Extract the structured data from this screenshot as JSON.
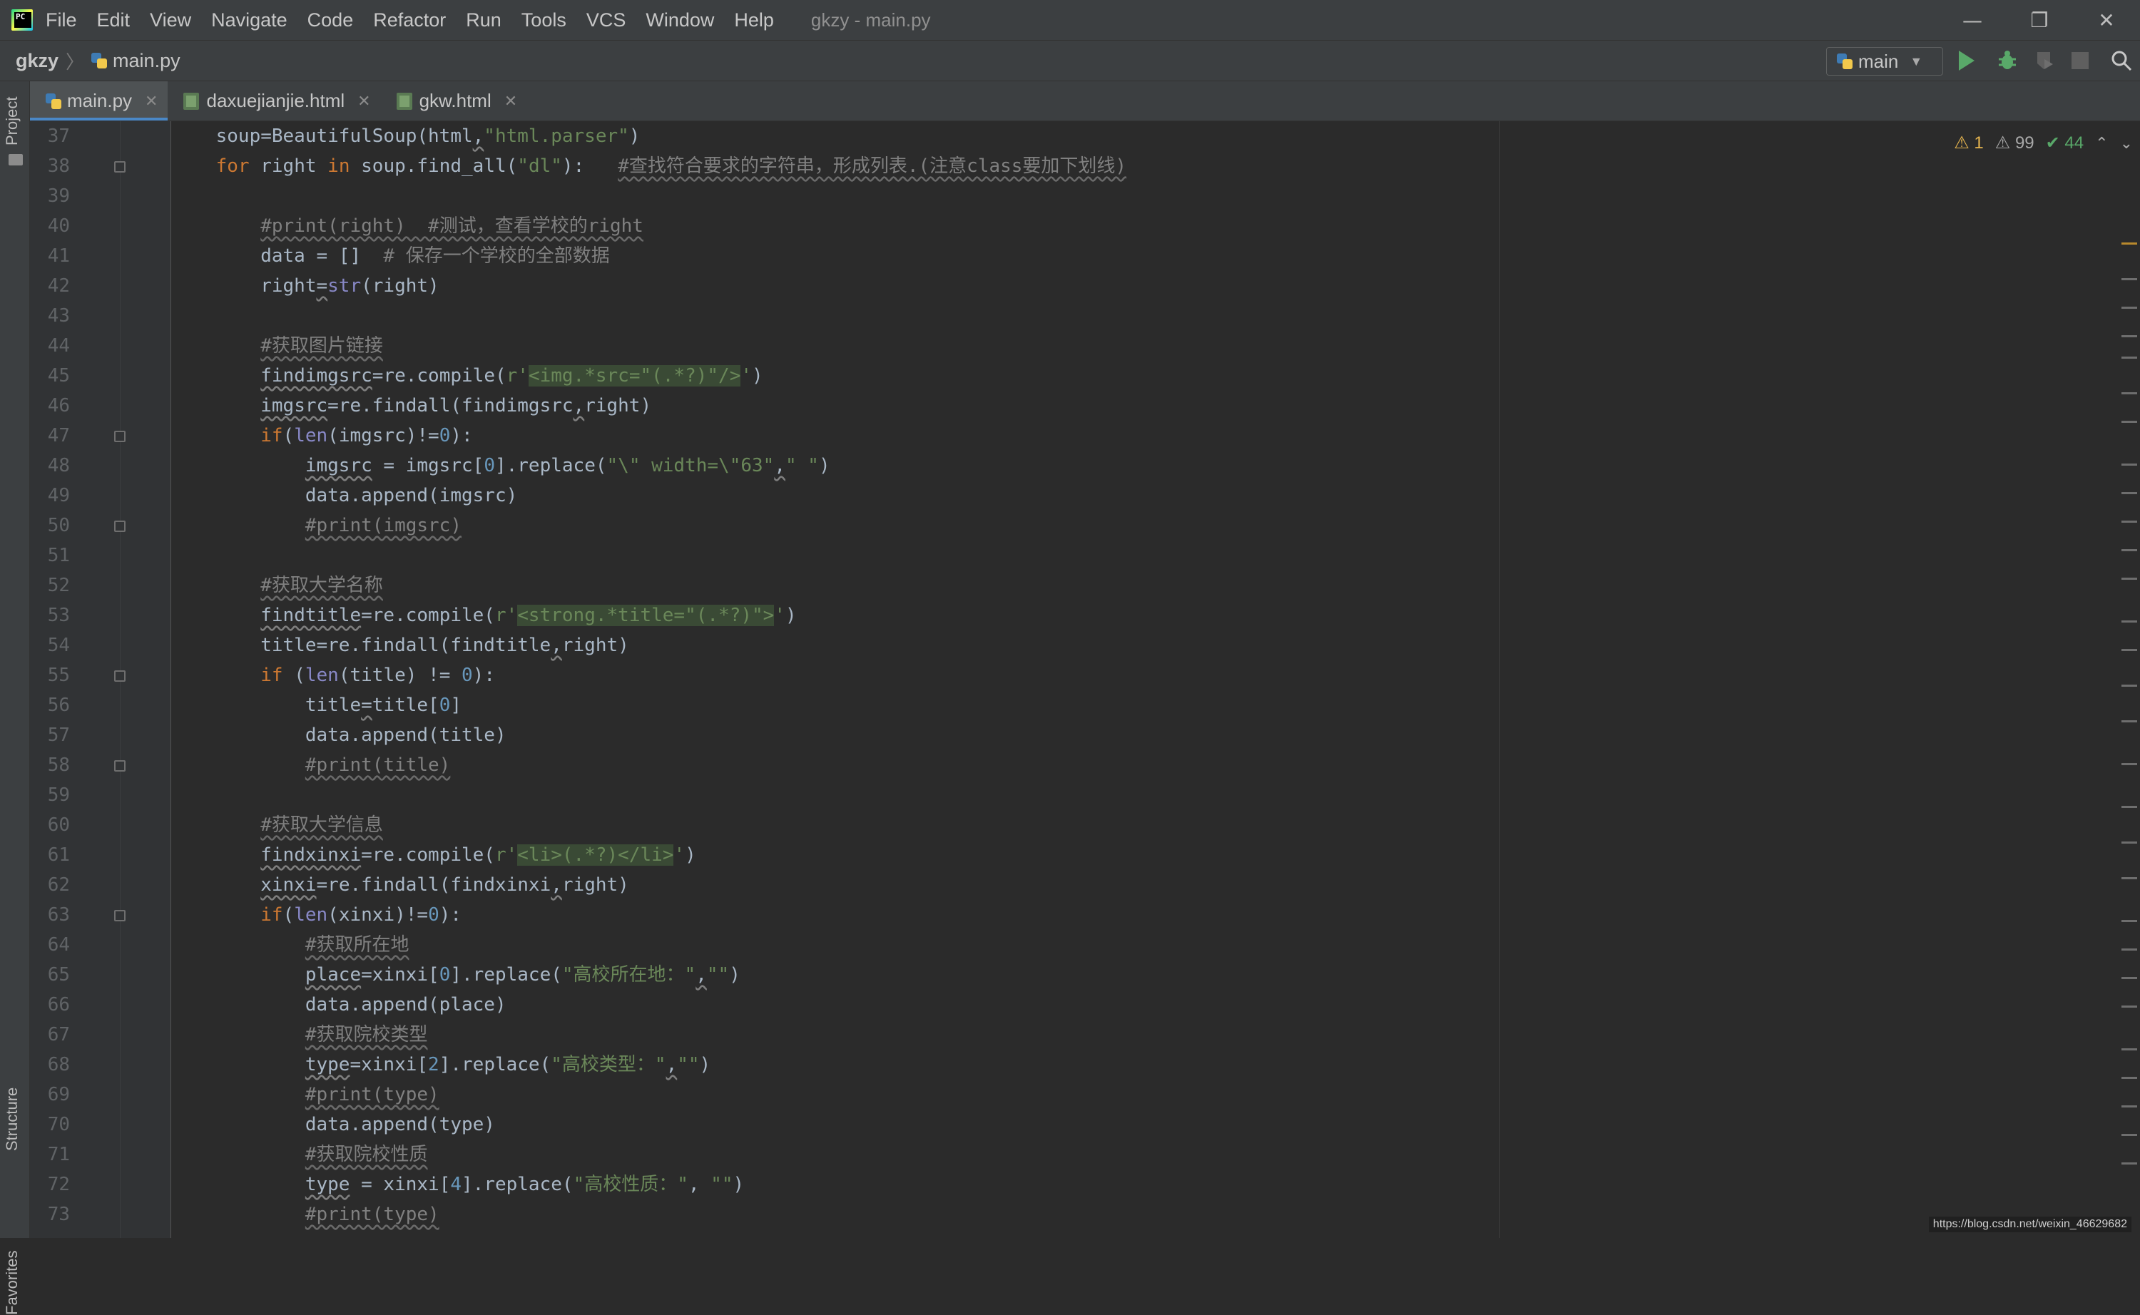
{
  "menu": {
    "items": [
      "File",
      "Edit",
      "View",
      "Navigate",
      "Code",
      "Refactor",
      "Run",
      "Tools",
      "VCS",
      "Window",
      "Help"
    ],
    "window_title": "gkzy - main.py"
  },
  "window_controls": {
    "minimize": "—",
    "restore": "❐",
    "close": "✕"
  },
  "navbar": {
    "project": "gkzy",
    "separator": "〉",
    "file": "main.py",
    "run_config": "main"
  },
  "left_strip": {
    "project_label": "Project",
    "structure_label": "Structure",
    "favorites_label": "Favorites"
  },
  "tabs": [
    {
      "label": "main.py",
      "active": true
    },
    {
      "label": "daxuejianjie.html",
      "active": false
    },
    {
      "label": "gkw.html",
      "active": false
    }
  ],
  "tab_close": "✕",
  "inspections": {
    "errors": "1",
    "warnings": "99",
    "ok": "44"
  },
  "watermark": "https://blog.csdn.net/weixin_46629682",
  "colors": {
    "keyword": "#cc7832",
    "string": "#6a8759",
    "comment": "#808080",
    "number": "#6897bb",
    "accent_tab": "#4a88c7"
  },
  "code": [
    {
      "n": "37",
      "fold": false,
      "html": "    soup=BeautifulSoup(html<span class=\"ul\">,</span><span class=\"str\">\"html.parser\"</span>)"
    },
    {
      "n": "38",
      "fold": true,
      "html": "    <span class=\"kw\">for</span> right <span class=\"kw\">in</span> soup.find_all(<span class=\"str\">\"dl\"</span>):   <span class=\"cm\">#查找符合要求的字符串，形成列表.(注意class要加下划线)</span>"
    },
    {
      "n": "39",
      "fold": false,
      "html": ""
    },
    {
      "n": "40",
      "fold": false,
      "html": "        <span class=\"cm\">#print(right)  #测试，查看学校的right</span>"
    },
    {
      "n": "41",
      "fold": false,
      "html": "        data = []  <span class=\"cm\" style=\"text-decoration:none\"># 保存一个学校的全部数据</span>"
    },
    {
      "n": "42",
      "fold": false,
      "html": "        right<span class=\"ul\">=</span><span class=\"bi\">str</span>(right)"
    },
    {
      "n": "43",
      "fold": false,
      "html": ""
    },
    {
      "n": "44",
      "fold": false,
      "html": "        <span class=\"cm\">#获取图片链接</span>"
    },
    {
      "n": "45",
      "fold": false,
      "html": "        <span class=\"ul\">findimgsrc</span>=re.compile(<span class=\"str\">r'</span><span class=\"str rx\">&lt;img.*src=\"(.*?)\"/&gt;</span><span class=\"str\">'</span>)"
    },
    {
      "n": "46",
      "fold": false,
      "html": "        <span class=\"ul\">imgsrc</span>=re.findall(findimgsrc<span class=\"ul\">,</span>right)"
    },
    {
      "n": "47",
      "fold": true,
      "html": "        <span class=\"kw\">if</span>(<span class=\"bi\">len</span>(imgsrc)!=<span class=\"num\">0</span>):"
    },
    {
      "n": "48",
      "fold": false,
      "html": "            <span class=\"ul\">imgsrc</span> = imgsrc[<span class=\"num\">0</span>].replace(<span class=\"str\">\"\\\" width=\\\"63\"</span><span class=\"ul\">,</span><span class=\"str\">\" \"</span>)"
    },
    {
      "n": "49",
      "fold": false,
      "html": "            data.append(imgsrc)"
    },
    {
      "n": "50",
      "fold": true,
      "html": "            <span class=\"cm\">#print(imgsrc)</span>"
    },
    {
      "n": "51",
      "fold": false,
      "html": ""
    },
    {
      "n": "52",
      "fold": false,
      "html": "        <span class=\"cm\">#获取大学名称</span>"
    },
    {
      "n": "53",
      "fold": false,
      "html": "        <span class=\"ul\">findtitle</span>=re.compile(<span class=\"str\">r'</span><span class=\"str rx\">&lt;strong.*title=\"(.*?)\"&gt;</span><span class=\"str\">'</span>)"
    },
    {
      "n": "54",
      "fold": false,
      "html": "        title=re.findall(findtitle<span class=\"ul\">,</span>right)"
    },
    {
      "n": "55",
      "fold": true,
      "html": "        <span class=\"kw\">if</span> (<span class=\"bi\">len</span>(title) != <span class=\"num\">0</span>):"
    },
    {
      "n": "56",
      "fold": false,
      "html": "            title<span class=\"ul\">=</span>title[<span class=\"num\">0</span>]"
    },
    {
      "n": "57",
      "fold": false,
      "html": "            data.append(title)"
    },
    {
      "n": "58",
      "fold": true,
      "html": "            <span class=\"cm\">#print(title)</span>"
    },
    {
      "n": "59",
      "fold": false,
      "html": ""
    },
    {
      "n": "60",
      "fold": false,
      "html": "        <span class=\"cm\">#获取大学信息</span>"
    },
    {
      "n": "61",
      "fold": false,
      "html": "        <span class=\"ul\">findxinxi</span>=re.compile(<span class=\"str\">r'</span><span class=\"str rx\">&lt;li&gt;(.*?)&lt;/li&gt;</span><span class=\"str\">'</span>)"
    },
    {
      "n": "62",
      "fold": false,
      "html": "        <span class=\"ul\">xinxi</span>=re.findall(findxinxi<span class=\"ul\">,</span>right)"
    },
    {
      "n": "63",
      "fold": true,
      "html": "        <span class=\"kw\">if</span>(<span class=\"bi\">len</span>(xinxi)!=<span class=\"num\">0</span>):"
    },
    {
      "n": "64",
      "fold": false,
      "html": "            <span class=\"cm\">#获取所在地</span>"
    },
    {
      "n": "65",
      "fold": false,
      "html": "            <span class=\"ul\">place</span>=xinxi[<span class=\"num\">0</span>].replace(<span class=\"str\">\"高校所在地：\"</span><span class=\"ul\">,</span><span class=\"str\">\"\"</span>)"
    },
    {
      "n": "66",
      "fold": false,
      "html": "            data.append(place)"
    },
    {
      "n": "67",
      "fold": false,
      "html": "            <span class=\"cm\">#获取院校类型</span>"
    },
    {
      "n": "68",
      "fold": false,
      "html": "            <span class=\"ul\">type</span>=xinxi[<span class=\"num\">2</span>].replace(<span class=\"str\">\"高校类型：\"</span><span class=\"ul\">,</span><span class=\"str\">\"\"</span>)"
    },
    {
      "n": "69",
      "fold": false,
      "html": "            <span class=\"cm\">#print(type)</span>"
    },
    {
      "n": "70",
      "fold": false,
      "html": "            data.append(type)"
    },
    {
      "n": "71",
      "fold": false,
      "html": "            <span class=\"cm\">#获取院校性质</span>"
    },
    {
      "n": "72",
      "fold": false,
      "html": "            <span class=\"ul\">type</span> = xinxi[<span class=\"num\">4</span>].replace(<span class=\"str\">\"高校性质：\"</span>, <span class=\"str\">\"\"</span>)"
    },
    {
      "n": "73",
      "fold": false,
      "html": "            <span class=\"cm\">#print(type)</span>"
    }
  ]
}
